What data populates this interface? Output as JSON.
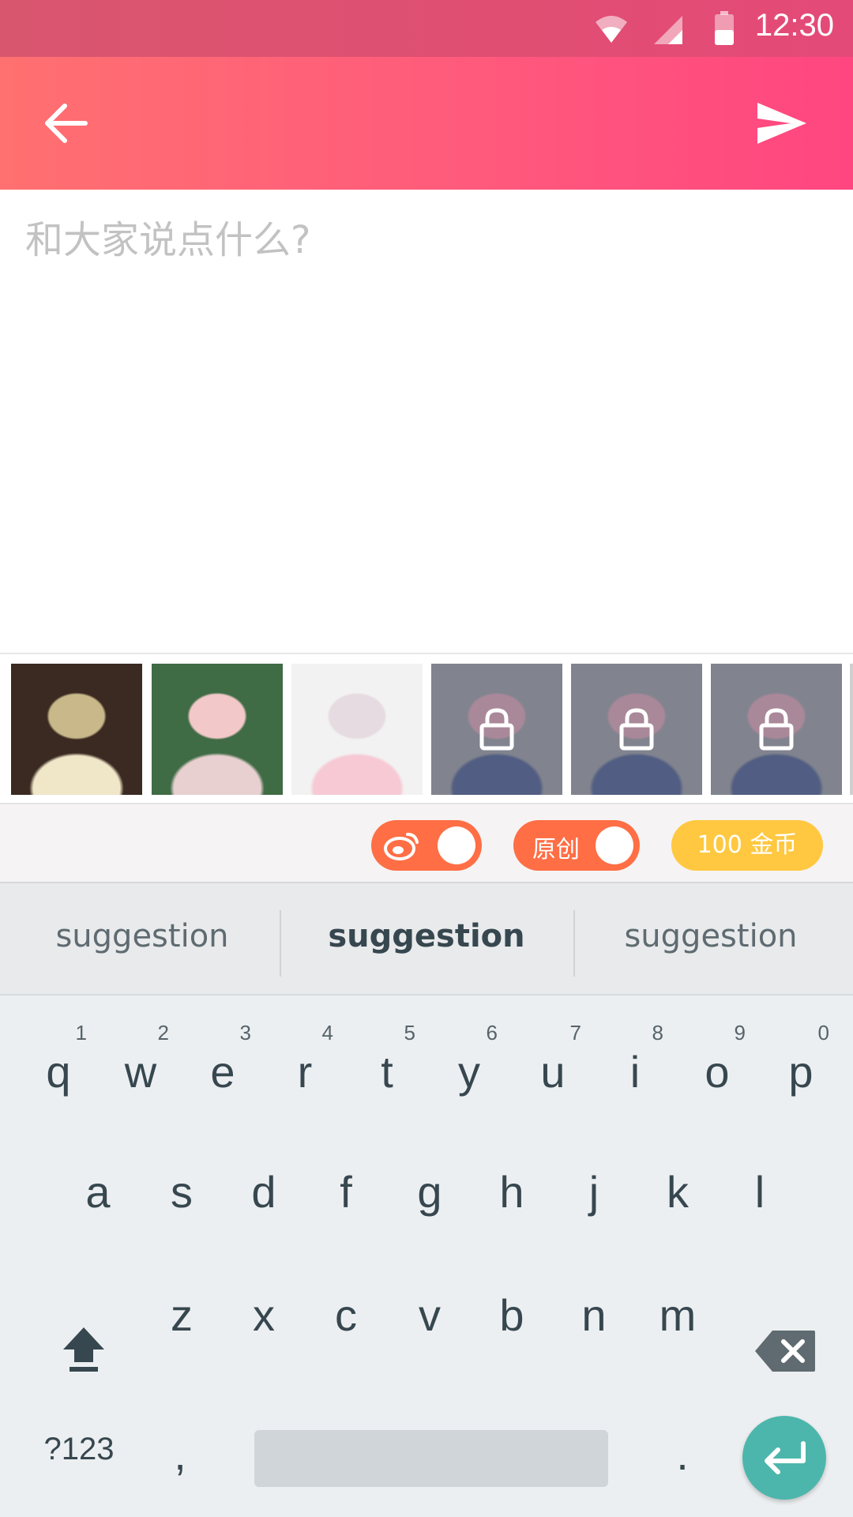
{
  "status_bar": {
    "time": "12:30"
  },
  "compose": {
    "placeholder": "和大家说点什么?"
  },
  "thumbnails": [
    {
      "locked": false,
      "palette": [
        "#3b2a22",
        "#c9b98a",
        "#f0e6c8"
      ]
    },
    {
      "locked": false,
      "palette": [
        "#3f6b45",
        "#f2c8c8",
        "#e8d0d0"
      ]
    },
    {
      "locked": false,
      "palette": [
        "#f2f2f2",
        "#e6dbe0",
        "#f6c9d4"
      ]
    },
    {
      "locked": true,
      "palette": [
        "#9aa0aa",
        "#f2a8c0",
        "#2f4b8e"
      ]
    },
    {
      "locked": true,
      "palette": [
        "#9aa0aa",
        "#f2a8c0",
        "#2f4b8e"
      ]
    },
    {
      "locked": true,
      "palette": [
        "#9aa0aa",
        "#f2a8c0",
        "#2f4b8e"
      ]
    }
  ],
  "options": {
    "original_label": "原创",
    "coins_label": "100 金币",
    "weibo_toggle_on": true,
    "original_toggle_on": true
  },
  "keyboard": {
    "suggestions": [
      "suggestion",
      "suggestion",
      "suggestion"
    ],
    "row1": [
      {
        "key": "q",
        "hint": "1"
      },
      {
        "key": "w",
        "hint": "2"
      },
      {
        "key": "e",
        "hint": "3"
      },
      {
        "key": "r",
        "hint": "4"
      },
      {
        "key": "t",
        "hint": "5"
      },
      {
        "key": "y",
        "hint": "6"
      },
      {
        "key": "u",
        "hint": "7"
      },
      {
        "key": "i",
        "hint": "8"
      },
      {
        "key": "o",
        "hint": "9"
      },
      {
        "key": "p",
        "hint": "0"
      }
    ],
    "row2": [
      "a",
      "s",
      "d",
      "f",
      "g",
      "h",
      "j",
      "k",
      "l"
    ],
    "row3": [
      "z",
      "x",
      "c",
      "v",
      "b",
      "n",
      "m"
    ],
    "symbols_label": "?123",
    "comma": ",",
    "period": "."
  },
  "colors": {
    "toolbar_start": "#ff7070",
    "toolbar_end": "#ff4680",
    "toggle": "#ff6e45",
    "coins": "#ffc840",
    "enter": "#4db6ac"
  }
}
